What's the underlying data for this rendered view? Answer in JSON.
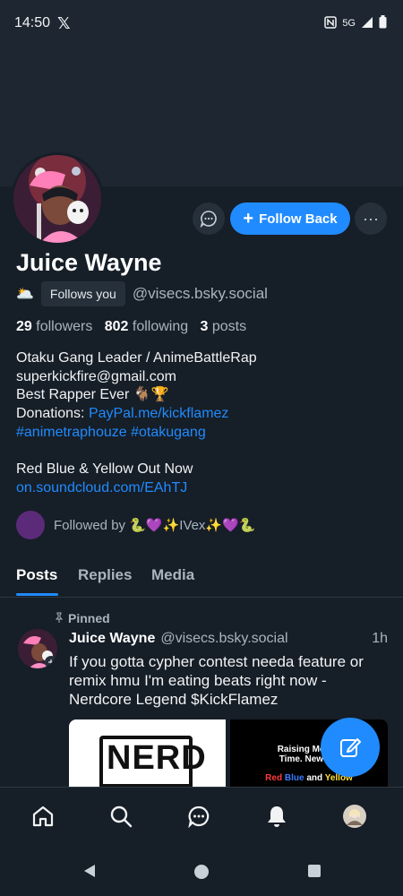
{
  "status_bar": {
    "time": "14:50",
    "network": "5G"
  },
  "profile": {
    "display_name": "Juice Wayne",
    "emoji_badge": "🌥️",
    "follows_you": "Follows you",
    "handle": "@visecs.bsky.social",
    "followers_count": "29",
    "followers_label": "followers",
    "following_count": "802",
    "following_label": "following",
    "posts_count": "3",
    "posts_label": "posts",
    "bio": {
      "line1": "Otaku Gang Leader / AnimeBattleRap",
      "line2": "superkickfire@gmail.com",
      "line3": "Best Rapper Ever  🐐🏆",
      "line4_prefix": "Donations: ",
      "line4_link": "PayPal.me/kickflamez",
      "line5_tags": " #animetraphouze #otakugang",
      "line6": "Red Blue & Yellow Out Now",
      "line7_link": "on.soundcloud.com/EAhTJ"
    },
    "followed_by": "Followed by 🐍💜✨IVex✨💜🐍"
  },
  "actions": {
    "follow_back_label": "Follow Back"
  },
  "tabs": [
    {
      "label": "Posts",
      "active": true
    },
    {
      "label": "Replies",
      "active": false
    },
    {
      "label": "Media",
      "active": false
    }
  ],
  "pinned_post": {
    "pinned_label": "Pinned",
    "author_name": "Juice Wayne",
    "author_handle": "@visecs.bsky.social",
    "time": "1h",
    "text": "If you gotta cypher contest needa feature or remix hmu I'm eating beats right now - Nerdcore Legend $KickFlamez",
    "image1_text": "NERD",
    "image2_text_a": "Raising Money",
    "image2_text_b": "Time. New Mu",
    "image2_text_c_red": "Red",
    "image2_text_c_blue": "Blue",
    "image2_text_c_and": "and",
    "image2_text_c_yellow": "Yellow"
  },
  "colors": {
    "accent": "#208bfe",
    "background": "#161e27",
    "surface": "#1e2731",
    "muted": "#aab4bf"
  },
  "bottom_nav": [
    "home-icon",
    "search-icon",
    "chat-icon",
    "notifications-icon",
    "profile-avatar"
  ]
}
